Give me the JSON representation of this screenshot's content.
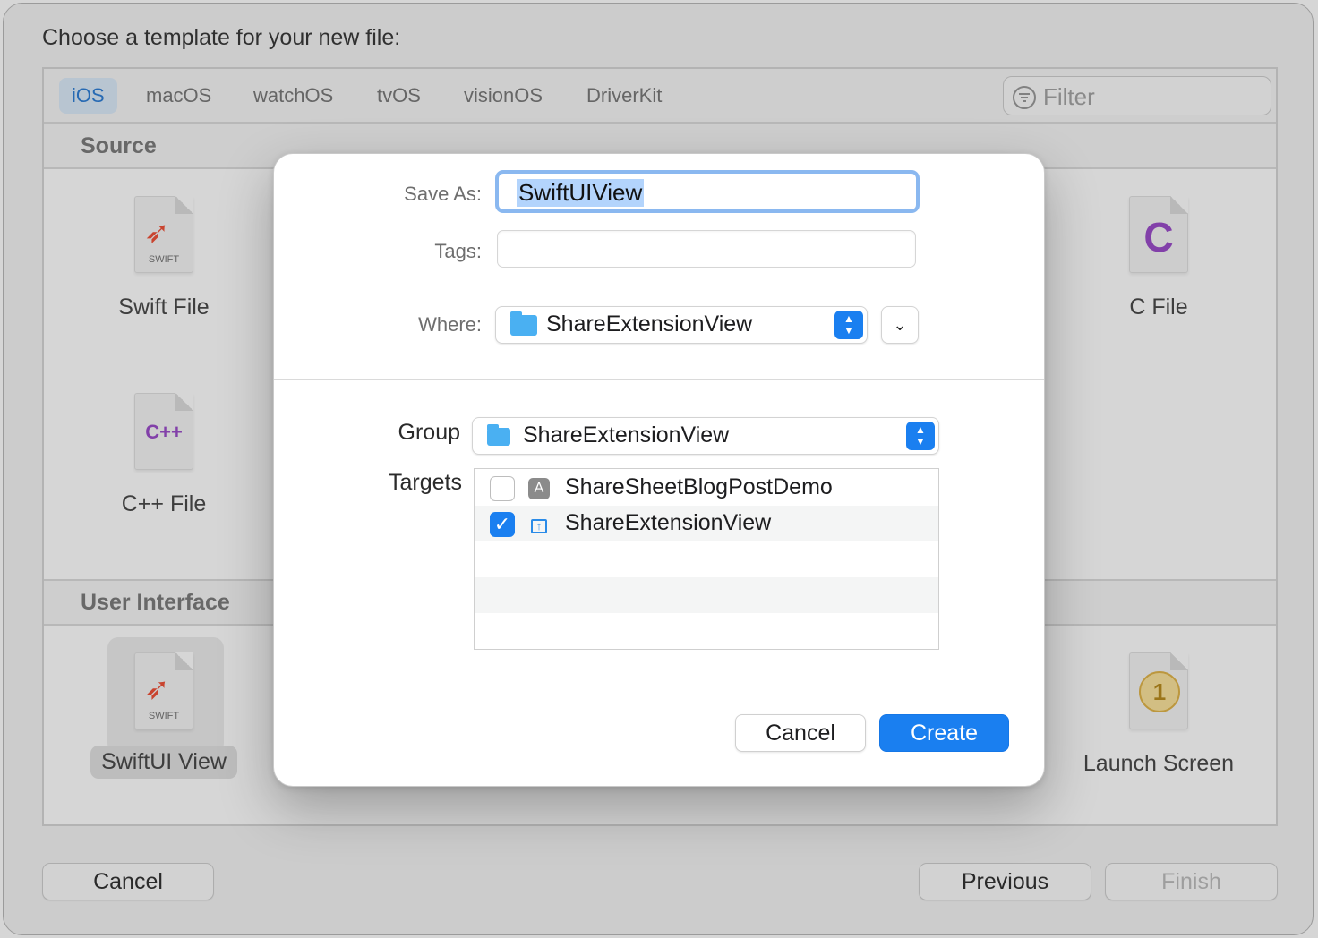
{
  "chooser": {
    "title": "Choose a template for your new file:",
    "platform_tabs": [
      "iOS",
      "macOS",
      "watchOS",
      "tvOS",
      "visionOS",
      "DriverKit"
    ],
    "active_tab": "iOS",
    "filter_placeholder": "Filter",
    "sections": [
      {
        "name": "Source",
        "templates": [
          "Swift File",
          "C++ File",
          "C File"
        ]
      },
      {
        "name": "User Interface",
        "templates": [
          "SwiftUI View",
          "Launch Screen"
        ]
      }
    ],
    "selected_template": "SwiftUI View",
    "icon_texts": {
      "swift": "SWIFT",
      "cpp": "C++",
      "c": "C",
      "launch": "1"
    },
    "buttons": {
      "cancel": "Cancel",
      "previous": "Previous",
      "finish": "Finish"
    }
  },
  "sheet": {
    "save_as_label": "Save As:",
    "save_as_value": "SwiftUIView",
    "tags_label": "Tags:",
    "tags_value": "",
    "where_label": "Where:",
    "where_value": "ShareExtensionView",
    "group_label": "Group",
    "group_value": "ShareExtensionView",
    "targets_label": "Targets",
    "targets": [
      {
        "name": "ShareSheetBlogPostDemo",
        "checked": false,
        "icon": "app-store-icon"
      },
      {
        "name": "ShareExtensionView",
        "checked": true,
        "icon": "share-icon"
      }
    ],
    "cancel_label": "Cancel",
    "create_label": "Create"
  },
  "colors": {
    "accent": "#1a7ff0",
    "selection": "#b3d4fc",
    "folder": "#4ab0f2"
  }
}
